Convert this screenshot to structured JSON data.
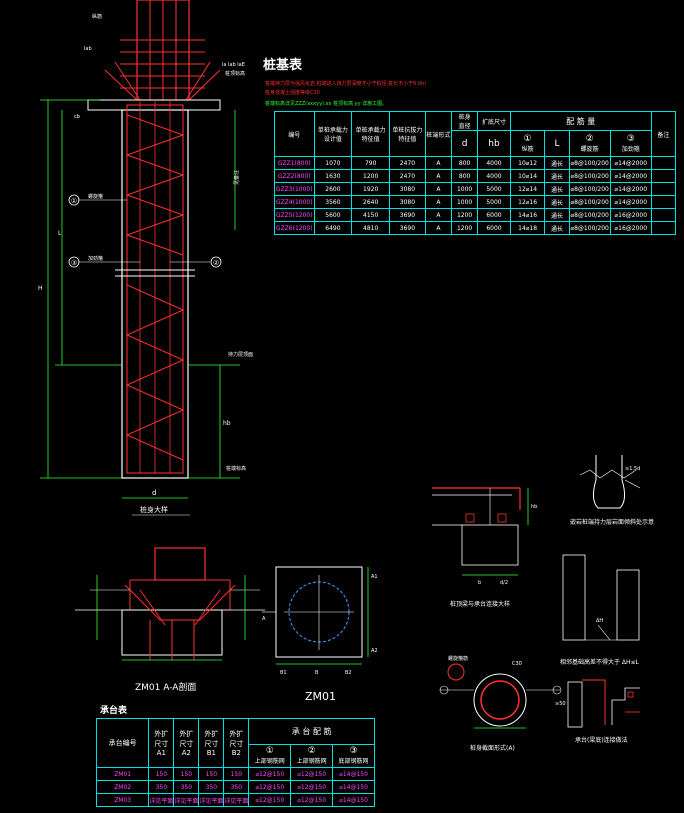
{
  "pile_table": {
    "title": "桩基表",
    "note_red_1": "桩端持力层为强风化岩,桩端进入持力层深度不小于桩径,桩长不小于6.0m",
    "note_red_2": "桩身混凝土强度等级C30",
    "note_green": "桩端标高详见ZZZ(xxxyy).xx 桩顶标高 yy 详施工图。",
    "headers": {
      "no": "编号",
      "col1": [
        "单桩承载力",
        "设计值"
      ],
      "col2": [
        "单桩承载力",
        "特征值"
      ],
      "col3": [
        "单桩抗拔力",
        "特征值"
      ],
      "col4": "桩端形式",
      "col5": [
        "桩身",
        "直径"
      ],
      "col6": "扩底尺寸",
      "col7": "配 筋 量",
      "col8": "备注",
      "sub_d": "d",
      "sub_hb": "hb",
      "bar1": "①",
      "bar1_label": "纵筋",
      "bar_l": "L",
      "bar2": "②",
      "bar2_label": "螺旋筋",
      "bar3": "③",
      "bar3_label": "加劲箍"
    },
    "rows": [
      {
        "no": "GZZ1(800)",
        "c1": "1070",
        "c2": "790",
        "c3": "2470",
        "c4": "A",
        "d": "800",
        "hb": "4000",
        "b1": "10⌀12",
        "l": "通长",
        "b2": "⌀8@100/200",
        "b3": "⌀14@2000"
      },
      {
        "no": "GZZ2(800)",
        "c1": "1630",
        "c2": "1200",
        "c3": "2470",
        "c4": "A",
        "d": "800",
        "hb": "4000",
        "b1": "10⌀14",
        "l": "通长",
        "b2": "⌀8@100/200",
        "b3": "⌀14@2000"
      },
      {
        "no": "GZZ3(1000)",
        "c1": "2600",
        "c2": "1920",
        "c3": "3080",
        "c4": "A",
        "d": "1000",
        "hb": "5000",
        "b1": "12⌀14",
        "l": "通长",
        "b2": "⌀8@100/200",
        "b3": "⌀14@2000"
      },
      {
        "no": "GZZ4(1000)",
        "c1": "3560",
        "c2": "2640",
        "c3": "3080",
        "c4": "A",
        "d": "1000",
        "hb": "5000",
        "b1": "12⌀16",
        "l": "通长",
        "b2": "⌀8@100/200",
        "b3": "⌀14@2000"
      },
      {
        "no": "GZZ5(1200)",
        "c1": "5600",
        "c2": "4150",
        "c3": "3690",
        "c4": "A",
        "d": "1200",
        "hb": "6000",
        "b1": "14⌀16",
        "l": "通长",
        "b2": "⌀8@100/200",
        "b3": "⌀16@2000"
      },
      {
        "no": "GZZ6(1200)",
        "c1": "6490",
        "c2": "4810",
        "c3": "3690",
        "c4": "A",
        "d": "1200",
        "hb": "6000",
        "b1": "14⌀18",
        "l": "通长",
        "b2": "⌀8@100/200",
        "b3": "⌀16@2000"
      }
    ]
  },
  "cap_table": {
    "title": "承台表",
    "headers": {
      "no": "承台编号",
      "a1": [
        "外扩",
        "尺寸",
        "A1"
      ],
      "a2": [
        "外扩",
        "尺寸",
        "A2"
      ],
      "b1": [
        "外扩",
        "尺寸",
        "B1"
      ],
      "b2": [
        "外扩",
        "尺寸",
        "B2"
      ],
      "rebar": "承 台 配 筋",
      "r1": "①",
      "r1_label": "上部钢筋网",
      "r2": "②",
      "r2_label": "上部钢筋网",
      "r3": "③",
      "r3_label": "底部钢筋网"
    },
    "rows": [
      {
        "no": "ZM01",
        "a1": "150",
        "a2": "150",
        "b1": "150",
        "b2": "150",
        "r1": "⌀12@150",
        "r2": "⌀12@150",
        "r3": "⌀14@150"
      },
      {
        "no": "ZM02",
        "a1": "350",
        "a2": "350",
        "b1": "350",
        "b2": "350",
        "r1": "⌀12@150",
        "r2": "⌀12@150",
        "r3": "⌀14@150"
      },
      {
        "no": "ZM03",
        "a1": "详见平面",
        "a2": "详见平面",
        "b1": "详见平面",
        "b2": "详见平面",
        "r1": "⌀12@150",
        "r2": "⌀12@150",
        "r3": "⌀14@150"
      }
    ]
  },
  "drawings": {
    "pile_caption": "桩身大样",
    "label_d": "d",
    "label_L": "L",
    "label_H": "H",
    "label_hb": "hb",
    "label_cb": "cb",
    "label_lab": "lab",
    "label_top": "纵筋",
    "label_elev_top": "桩顶标高",
    "label_elev_bot": "桩端标高",
    "label_rock": "持力层顶面",
    "label_spiral": "螺旋箍",
    "label_stiff": "加劲箍",
    "label_dim": "la  lab  laE",
    "label_dim2": "见备注",
    "marker1": "①",
    "marker2": "②",
    "marker3": "③",
    "section_caption": "ZM01 A-A剖面",
    "plan_caption": "ZM01",
    "label_A": "A",
    "label_B": "B",
    "label_A1": "A1",
    "label_A2": "A2",
    "label_B1": "B1",
    "label_B2": "B2",
    "beam_caption": "桩顶梁与承台连接大样",
    "beam_b": "b",
    "beam_hb": "hb",
    "beam_d": "d/2",
    "crack_caption": "嵌岩桩端持力层岩面倾斜处示意",
    "crack_label": "≥1.5d",
    "slope_caption": "相邻基础高差不得大于 ΔH≤L",
    "slope_label": "ΔH",
    "ring_caption": "桩身截面形式(A)",
    "ring_label": "C30",
    "ring_spiral": "螺旋箍筋",
    "wall_caption": "承台(梁底)连接做法",
    "wall_label": "≥50"
  }
}
